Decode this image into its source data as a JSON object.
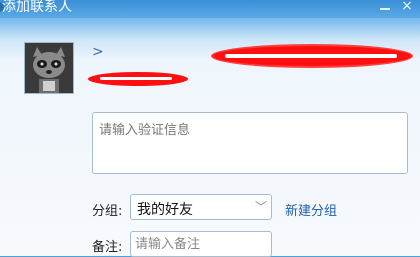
{
  "window": {
    "title": "添加联系人",
    "close_glyph": "×"
  },
  "profile": {
    "chevron": ">"
  },
  "verify": {
    "placeholder": "请输入验证信息"
  },
  "group": {
    "label": "分组:",
    "value": "我的好友",
    "new_group_link": "新建分组"
  },
  "note": {
    "label": "备注:",
    "placeholder": "请输入备注"
  }
}
